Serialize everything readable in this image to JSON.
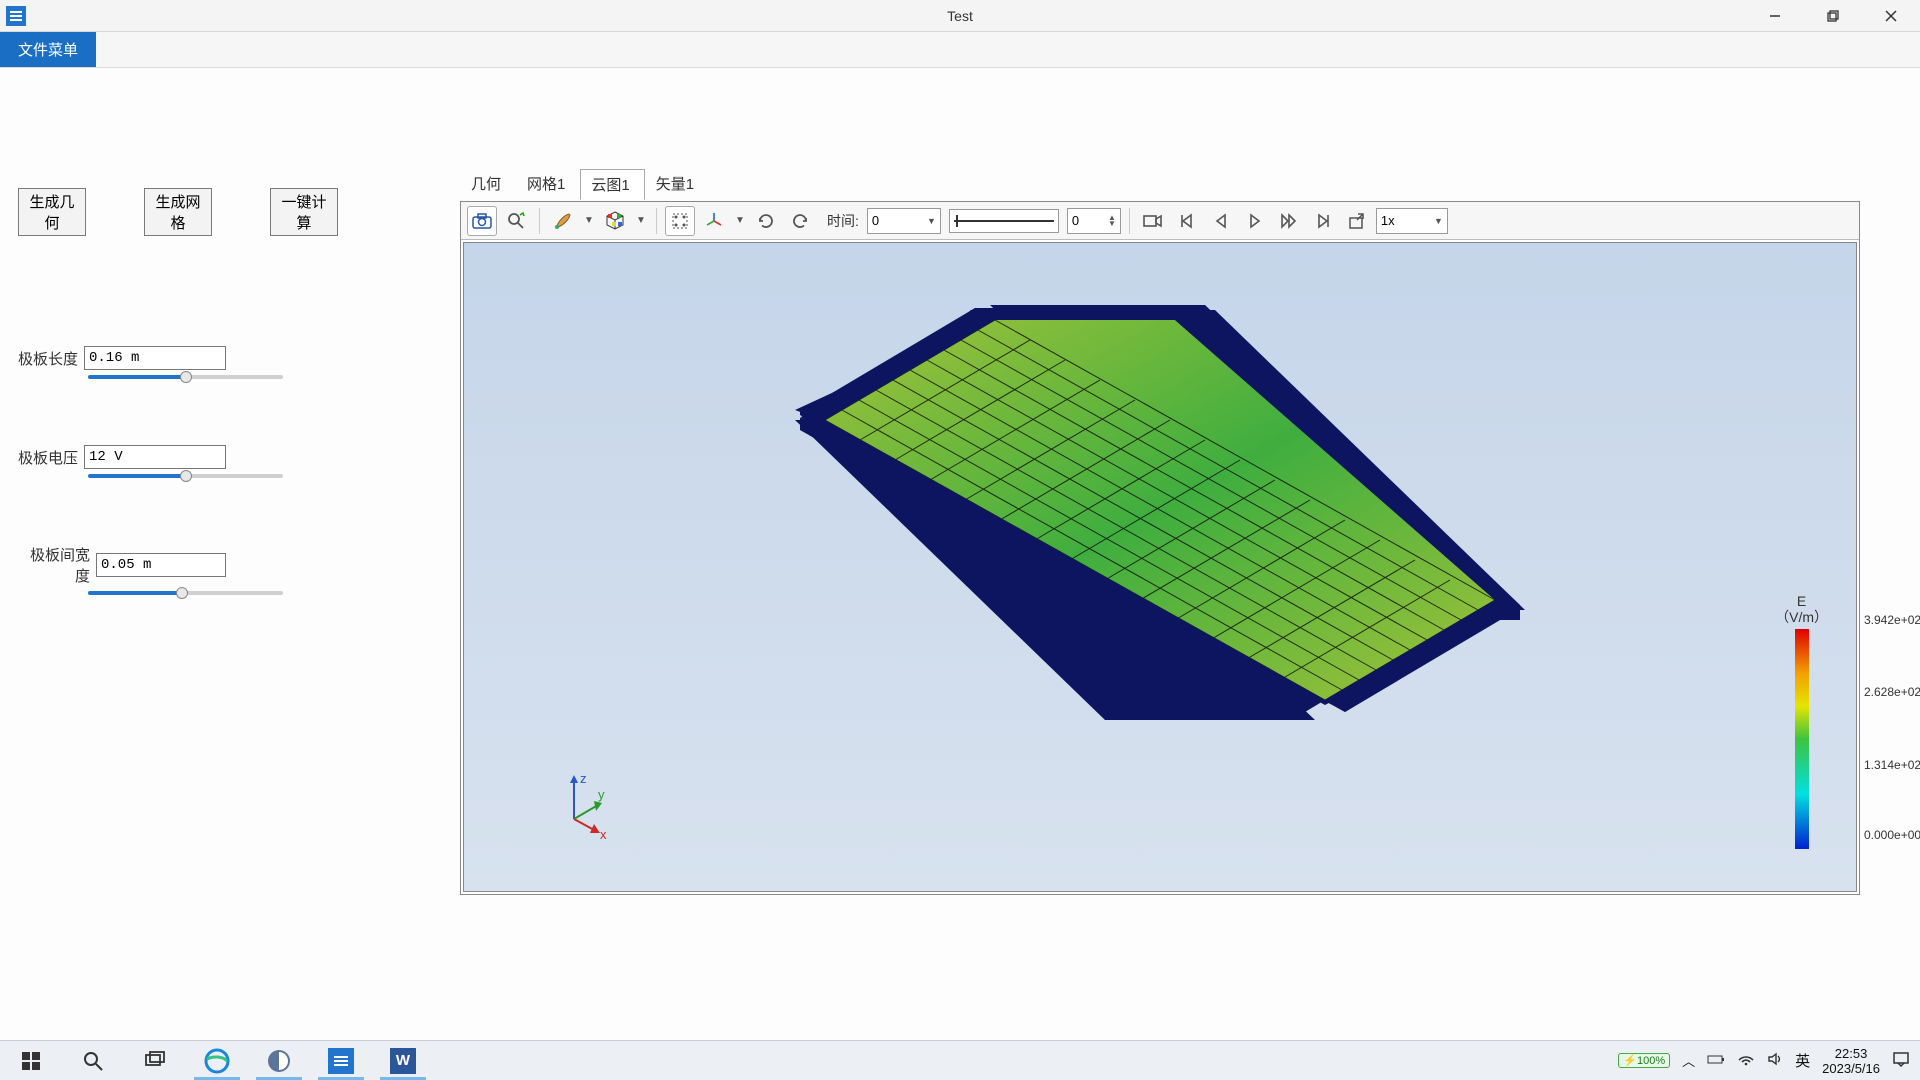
{
  "window": {
    "title": "Test",
    "menu": "文件菜单"
  },
  "buttons": {
    "gen_geom": "生成几何",
    "gen_mesh": "生成网格",
    "compute": "一键计算"
  },
  "params": {
    "length": {
      "label": "极板长度",
      "value": "0.16 m",
      "pct": 50
    },
    "voltage": {
      "label": "极板电压",
      "value": "12 V",
      "pct": 50
    },
    "gap": {
      "label": "极板间宽度",
      "value": "0.05 m",
      "pct": 48
    }
  },
  "tabs": {
    "geom": "几何",
    "mesh": "网格1",
    "cloud": "云图1",
    "vector": "矢量1"
  },
  "toolbar": {
    "time_label": "时间:",
    "time_value": "0",
    "frame_value": "0",
    "speed": "1x"
  },
  "legend": {
    "title1": "E",
    "title2": "（V/m）",
    "t0": "3.942e+02",
    "t1": "2.628e+02",
    "t2": "1.314e+02",
    "t3": "0.000e+00"
  },
  "axes": {
    "x": "x",
    "y": "y",
    "z": "z"
  },
  "taskbar": {
    "battery": "100%",
    "ime": "英",
    "time": "22:53",
    "date": "2023/5/16"
  }
}
